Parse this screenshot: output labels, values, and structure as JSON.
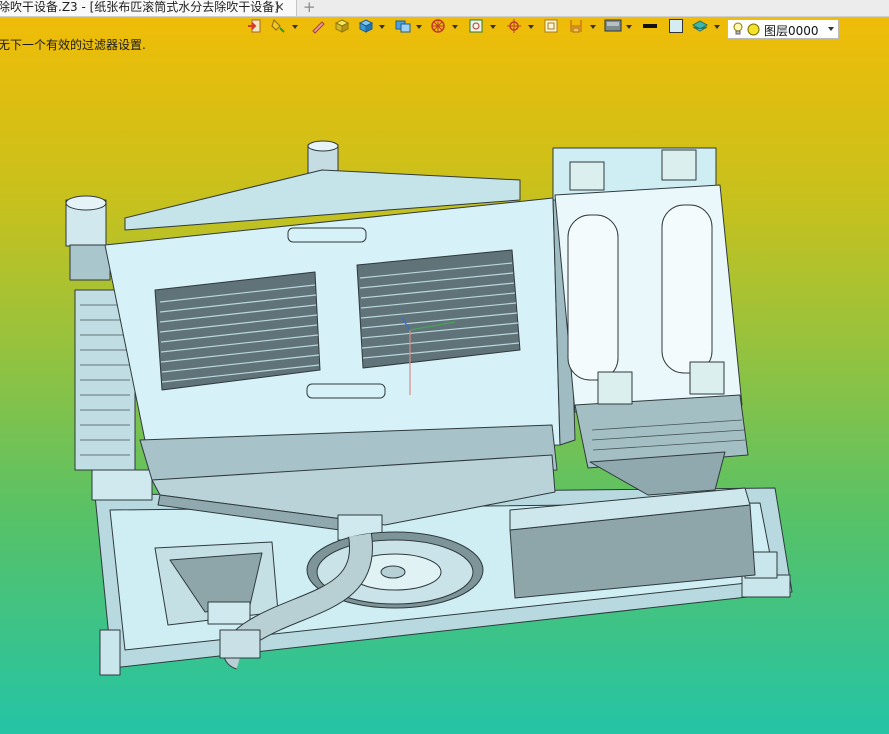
{
  "tab": {
    "title": "除吹干设备.Z3 - [纸张布匹滚筒式水分去除吹干设备]",
    "close": "×",
    "add": "+"
  },
  "status": {
    "message": "无下一个有效的过滤器设置."
  },
  "layer": {
    "name": "图层0000"
  },
  "colors": {
    "bg_top": "#f3bc05",
    "bg_bottom": "#24c4a6",
    "part_fill": "#d6f2f8",
    "part_dark": "#8fa9ae",
    "edge": "#2f3a3d"
  }
}
